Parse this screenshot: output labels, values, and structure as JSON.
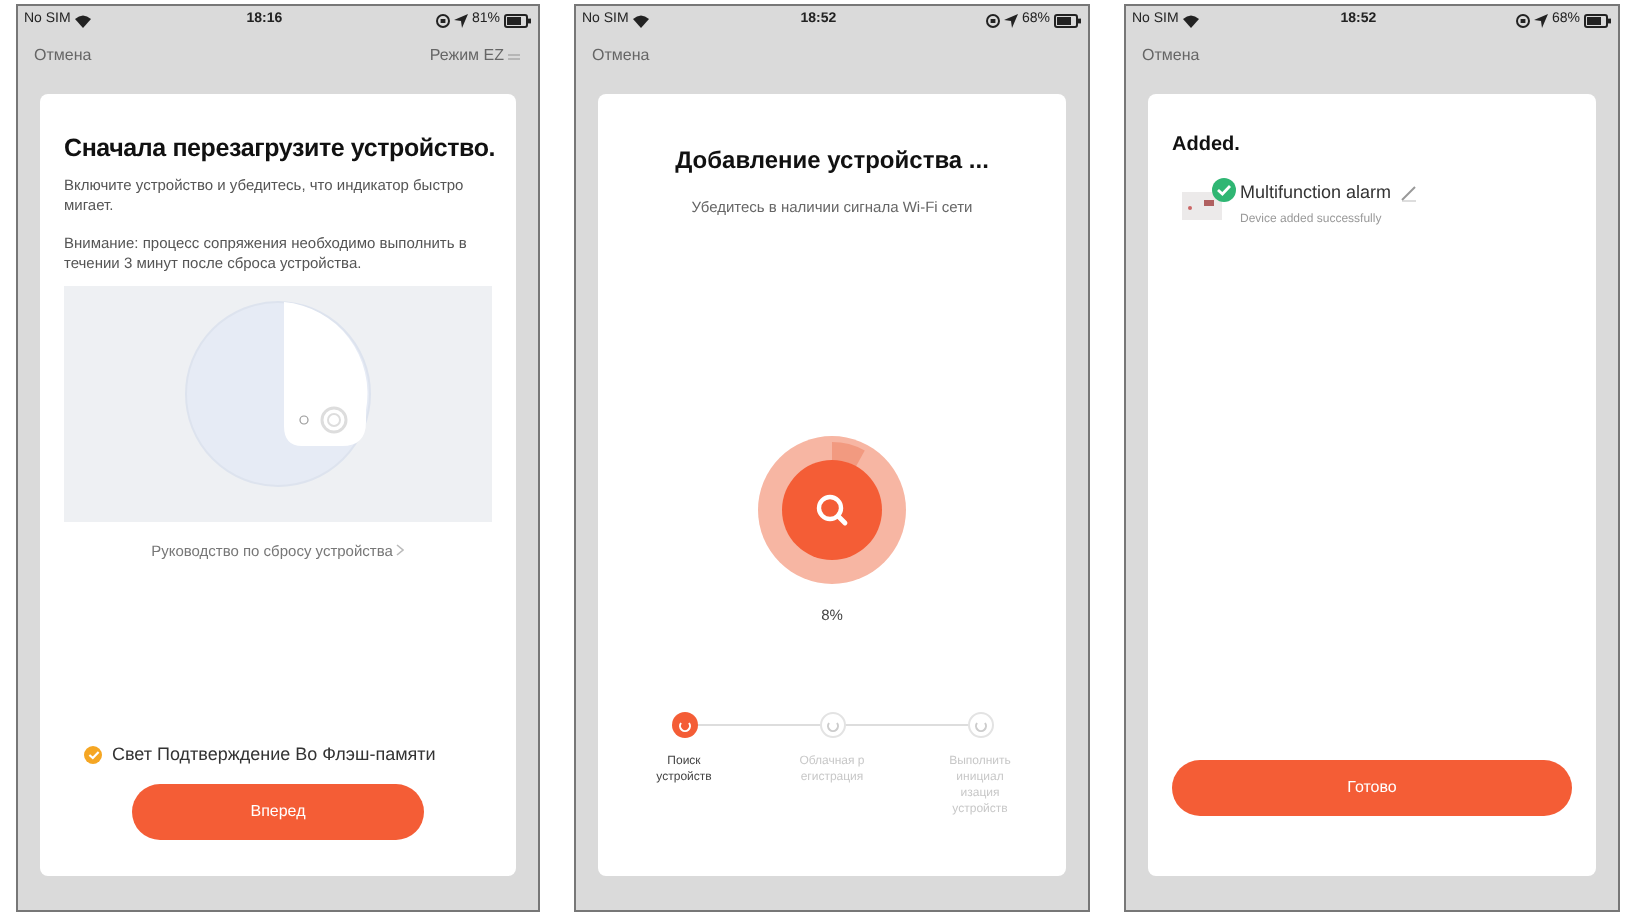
{
  "screens": [
    {
      "kind": "reset",
      "status_bar": {
        "carrier": "No SIM",
        "time": "18:16",
        "battery": "81%"
      },
      "nav": {
        "cancel": "Отмена",
        "mode": "Режим EZ"
      },
      "title": "Сначала перезагрузите устройство.",
      "paragraphs": [
        "Включите устройство и убедитесь, что индикатор быстро мигает.",
        "Внимание: процесс сопряжения необходимо выполнить в течении 3 минут после сброса устройства."
      ],
      "guide_link": "Руководство по сбросу устройства",
      "confirm": {
        "label": "Свет Подтверждение Во Флэш-памяти",
        "checked": true
      },
      "button": "Вперед"
    },
    {
      "kind": "adding",
      "status_bar": {
        "carrier": "No SIM",
        "time": "18:52",
        "battery": "68%"
      },
      "nav": {
        "cancel": "Отмена"
      },
      "title": "Добавление устройства ...",
      "subtitle": "Убедитесь в наличии сигнала Wi-Fi сети",
      "progress": {
        "reading": "8%"
      },
      "steps": [
        {
          "lines": [
            "Поиск",
            "устройств"
          ],
          "selected": true
        },
        {
          "lines": [
            "Облачная р",
            "егистрация"
          ],
          "selected": false
        },
        {
          "lines": [
            "Выполнить",
            "инициал",
            "изация",
            "устройств"
          ],
          "selected": false
        }
      ]
    },
    {
      "kind": "added",
      "status_bar": {
        "carrier": "No SIM",
        "time": "18:52",
        "battery": "68%"
      },
      "nav": {
        "cancel": "Отмена"
      },
      "title": "Added.",
      "device": {
        "name": "Multifunction alarm",
        "status": "Device added successfully"
      },
      "button": "Готово"
    }
  ]
}
